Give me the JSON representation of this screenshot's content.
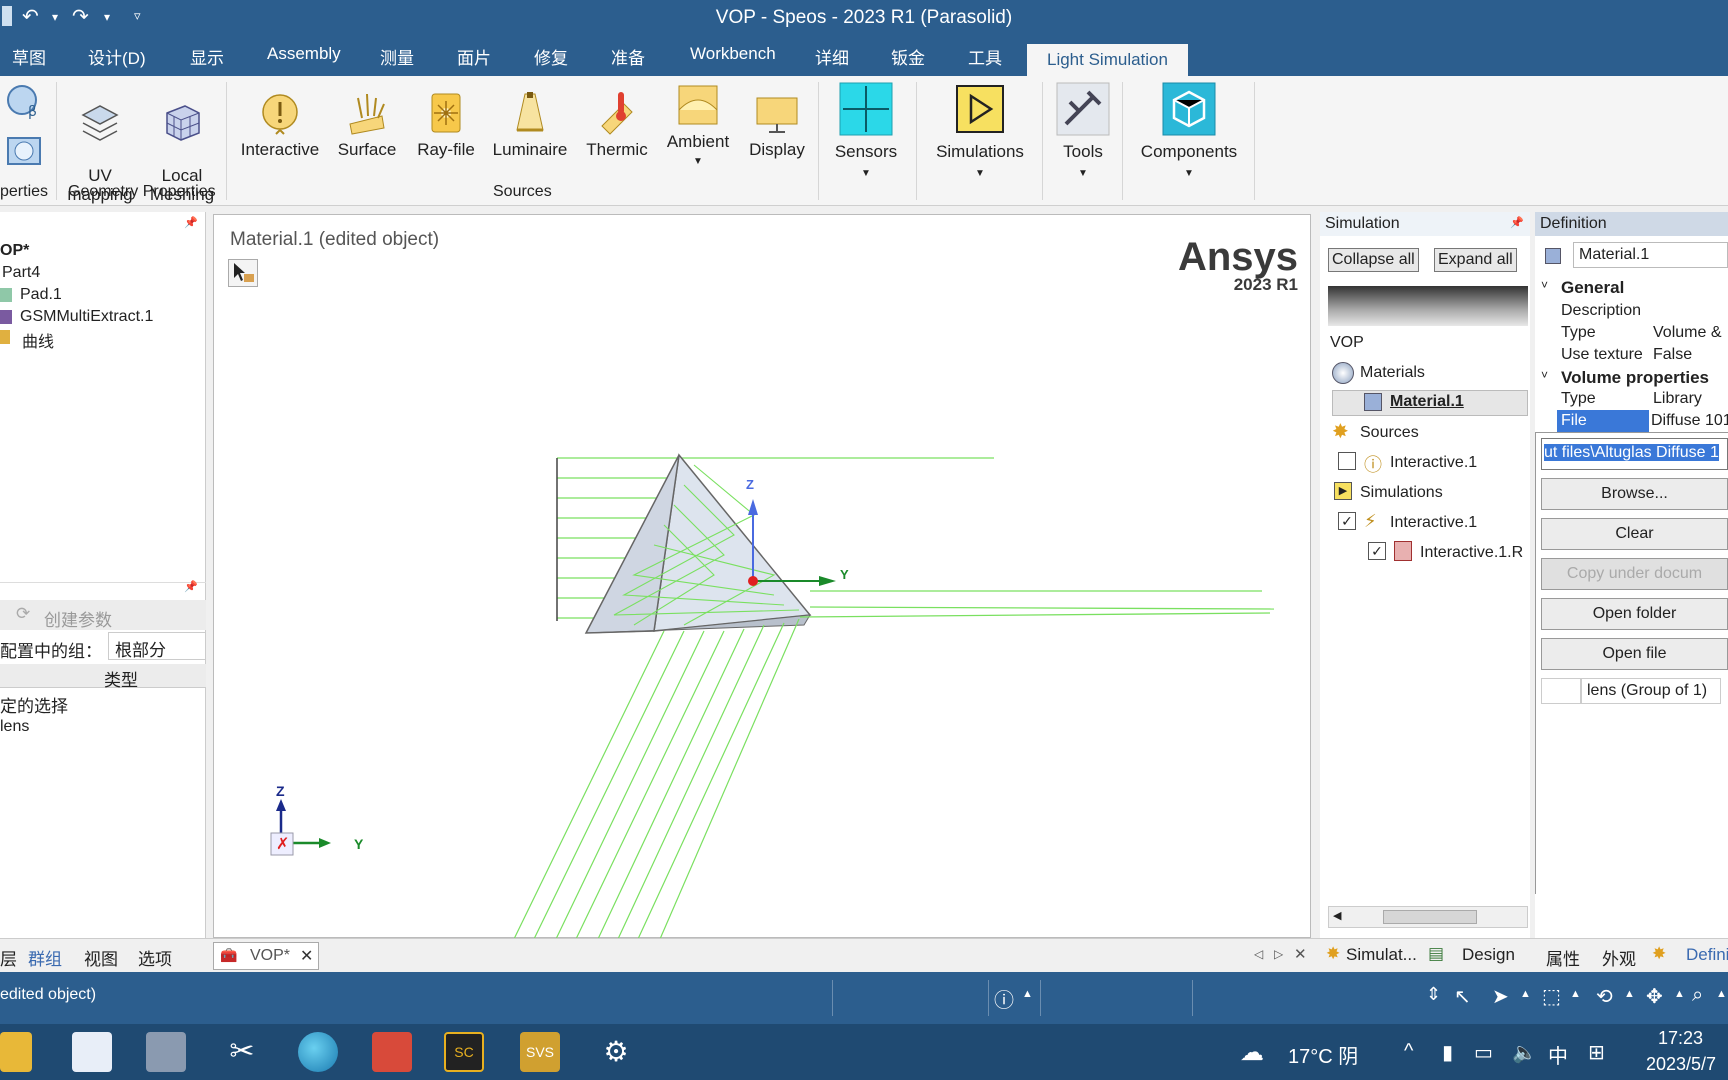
{
  "window": {
    "title": "VOP - Speos - 2023 R1 (Parasolid)"
  },
  "ribbon_tabs": [
    "草图",
    "设计(D)",
    "显示",
    "Assembly",
    "测量",
    "面片",
    "修复",
    "准备",
    "Workbench",
    "详细",
    "钣金",
    "工具",
    "Light Simulation"
  ],
  "ribbon": {
    "left_partial_group": "perties",
    "uv_mapping": "UV\nmapping",
    "local_meshing": "Local\nMeshing",
    "geometry_group": "Geometry Properties",
    "interactive": "Interactive",
    "surface": "Surface",
    "ray_file": "Ray-file",
    "luminaire": "Luminaire",
    "thermic": "Thermic",
    "ambient": "Ambient",
    "display": "Display",
    "sources_group": "Sources",
    "sensors": "Sensors",
    "simulations": "Simulations",
    "tools": "Tools",
    "components": "Components"
  },
  "left_tree": {
    "root": "OP*",
    "items": [
      "Part4",
      "Pad.1",
      "GSMMultiExtract.1",
      "曲线"
    ]
  },
  "left_props": {
    "create_param": "创建参数",
    "group_label": "配置中的组：",
    "group_value": "根部分",
    "col_type": "类型",
    "rows": [
      "定的选择",
      "lens"
    ]
  },
  "left_bottom_tabs": [
    "层",
    "群组",
    "视图",
    "选项"
  ],
  "viewport": {
    "title": "Material.1 (edited object)",
    "brand": "Ansys",
    "version": "2023 R1",
    "axis_z": "Z",
    "axis_y": "Y",
    "triad_z": "Z",
    "triad_y": "Y"
  },
  "simulation_panel": {
    "header": "Simulation",
    "collapse_all": "Collapse all",
    "expand_all": "Expand all",
    "root": "VOP",
    "materials": "Materials",
    "material1": "Material.1",
    "sources": "Sources",
    "source_interactive": "Interactive.1",
    "simulations": "Simulations",
    "sim_interactive": "Interactive.1",
    "sim_result": "Interactive.1.R"
  },
  "definition_panel": {
    "header": "Definition",
    "name": "Material.1",
    "general": "General",
    "description_label": "Description",
    "type_label": "Type",
    "type_value": "Volume &",
    "use_texture_label": "Use texture",
    "use_texture_value": "False",
    "volume_properties": "Volume properties",
    "vtype_label": "Type",
    "vtype_value": "Library",
    "file_label": "File",
    "file_value": "Diffuse 101",
    "file_path": "ut files\\Altuglas Diffuse 1",
    "browse": "Browse...",
    "clear": "Clear",
    "copy_under": "Copy under docum",
    "open_folder": "Open folder",
    "open_file": "Open file",
    "group_value": "lens (Group of 1)"
  },
  "bottom_tabs": {
    "doc_tab": "VOP*",
    "simulat": "Simulat...",
    "design": "Design",
    "props": "属性",
    "appearance": "外观",
    "defini": "Defini"
  },
  "status": {
    "text": "edited object)"
  },
  "taskbar": {
    "weather": "17°C  阴",
    "ime": "中",
    "time": "17:23",
    "date": "2023/5/7"
  }
}
